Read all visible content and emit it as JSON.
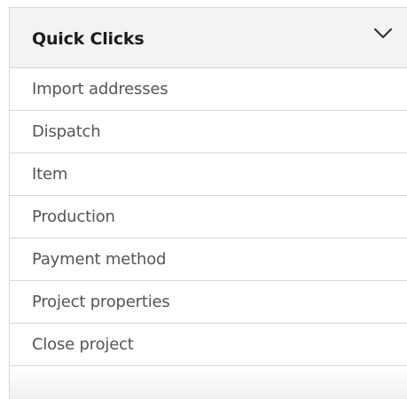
{
  "quick_clicks": {
    "title": "Quick Clicks",
    "toggle_icon": "chevron-down-icon",
    "items": [
      {
        "label": "Import addresses"
      },
      {
        "label": "Dispatch"
      },
      {
        "label": "Item"
      },
      {
        "label": "Production"
      },
      {
        "label": "Payment method"
      },
      {
        "label": "Project properties"
      },
      {
        "label": "Close project"
      }
    ]
  }
}
